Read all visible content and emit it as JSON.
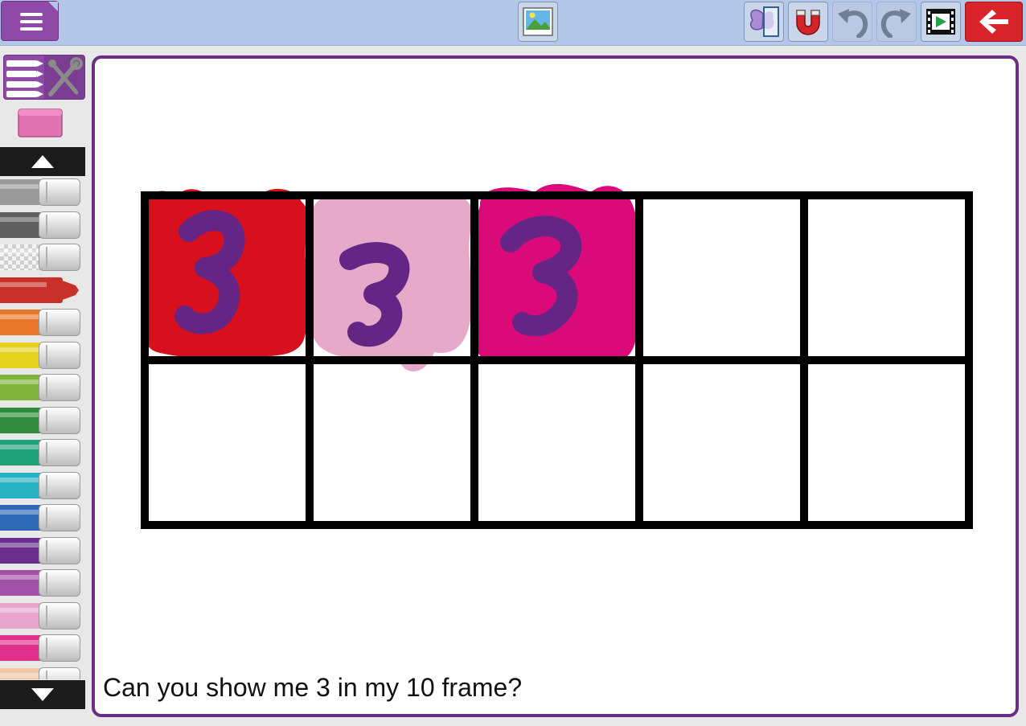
{
  "toolbar": {
    "menu_icon": "menu-icon",
    "buttons": [
      {
        "name": "image-picker",
        "icon": "picture-icon"
      },
      {
        "name": "mirror",
        "icon": "butterfly-icon"
      },
      {
        "name": "magnet",
        "icon": "magnet-icon"
      },
      {
        "name": "undo",
        "icon": "undo-icon"
      },
      {
        "name": "redo",
        "icon": "redo-icon"
      },
      {
        "name": "play",
        "icon": "filmstrip-icon"
      },
      {
        "name": "back",
        "icon": "arrow-left-icon"
      }
    ]
  },
  "sidebar": {
    "tools_icon": "tools-icon",
    "eraser_color": "#e273b3",
    "marker_colors": [
      "#9a9a9a",
      "#5f5f5f",
      "#d9d9d9",
      "#c8312a",
      "#e9772a",
      "#e5d320",
      "#7fb33a",
      "#2f8c3a",
      "#1fa27a",
      "#27b3c4",
      "#2e68b6",
      "#6a2f8e",
      "#a152a8",
      "#e8a6cf",
      "#df2f8a",
      "#f1c7a6"
    ],
    "selected_marker": 3
  },
  "canvas": {
    "prompt": "Can you show me 3 in my 10 frame?",
    "frame": {
      "rows": 2,
      "cols": 5
    },
    "drawn_counters": [
      {
        "fill": "#d8101e",
        "digit": "3",
        "digit_color": "#652585"
      },
      {
        "fill": "#e6a9c9",
        "digit": "3",
        "digit_color": "#652585"
      },
      {
        "fill": "#da0a7a",
        "digit": "3",
        "digit_color": "#652585"
      }
    ]
  }
}
